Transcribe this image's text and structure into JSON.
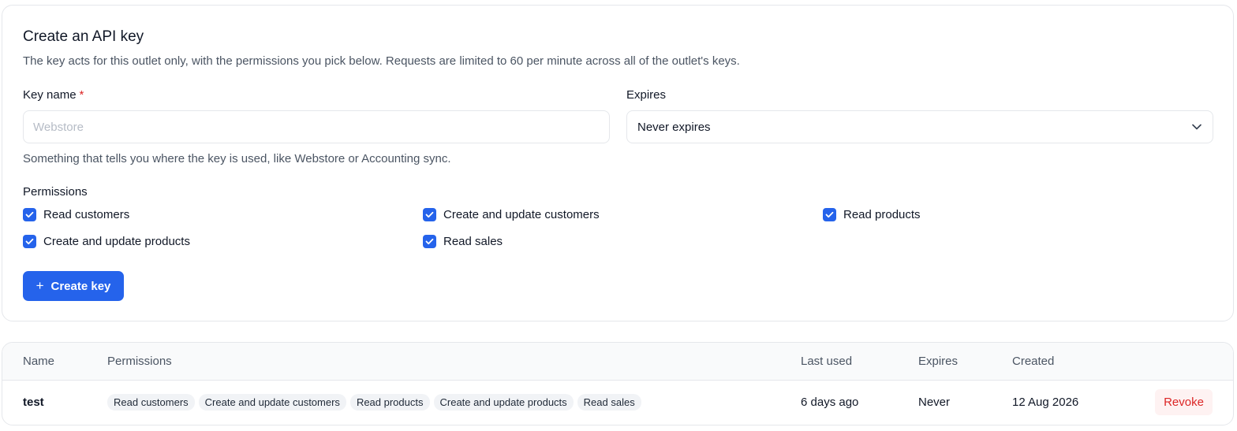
{
  "form": {
    "title": "Create an API key",
    "description": "The key acts for this outlet only, with the permissions you pick below. Requests are limited to 60 per minute across all of the outlet's keys.",
    "key_name_label": "Key name",
    "required_marker": "*",
    "key_name_value": "",
    "key_name_placeholder": "Webstore",
    "key_name_hint": "Something that tells you where the key is used, like Webstore or Accounting sync.",
    "expires_label": "Expires",
    "expires_value": "Never expires",
    "permissions_label": "Permissions",
    "permissions": [
      {
        "label": "Read customers",
        "checked": true
      },
      {
        "label": "Create and update customers",
        "checked": true
      },
      {
        "label": "Read products",
        "checked": true
      },
      {
        "label": "Create and update products",
        "checked": true
      },
      {
        "label": "Read sales",
        "checked": true
      }
    ],
    "create_button_label": "Create key",
    "create_button_icon": "plus-icon"
  },
  "table": {
    "columns": [
      "Name",
      "Permissions",
      "Last used",
      "Expires",
      "Created"
    ],
    "rows": [
      {
        "name": "test",
        "permissions": [
          "Read customers",
          "Create and update customers",
          "Read products",
          "Create and update products",
          "Read sales"
        ],
        "last_used": "6 days ago",
        "expires": "Never",
        "created": "12 Aug 2026",
        "action_label": "Revoke"
      }
    ]
  },
  "colors": {
    "accent": "#2563eb",
    "danger": "#dc2626",
    "danger_bg": "#fef2f2",
    "border": "#e5e7eb",
    "muted_text": "#4b5563"
  }
}
